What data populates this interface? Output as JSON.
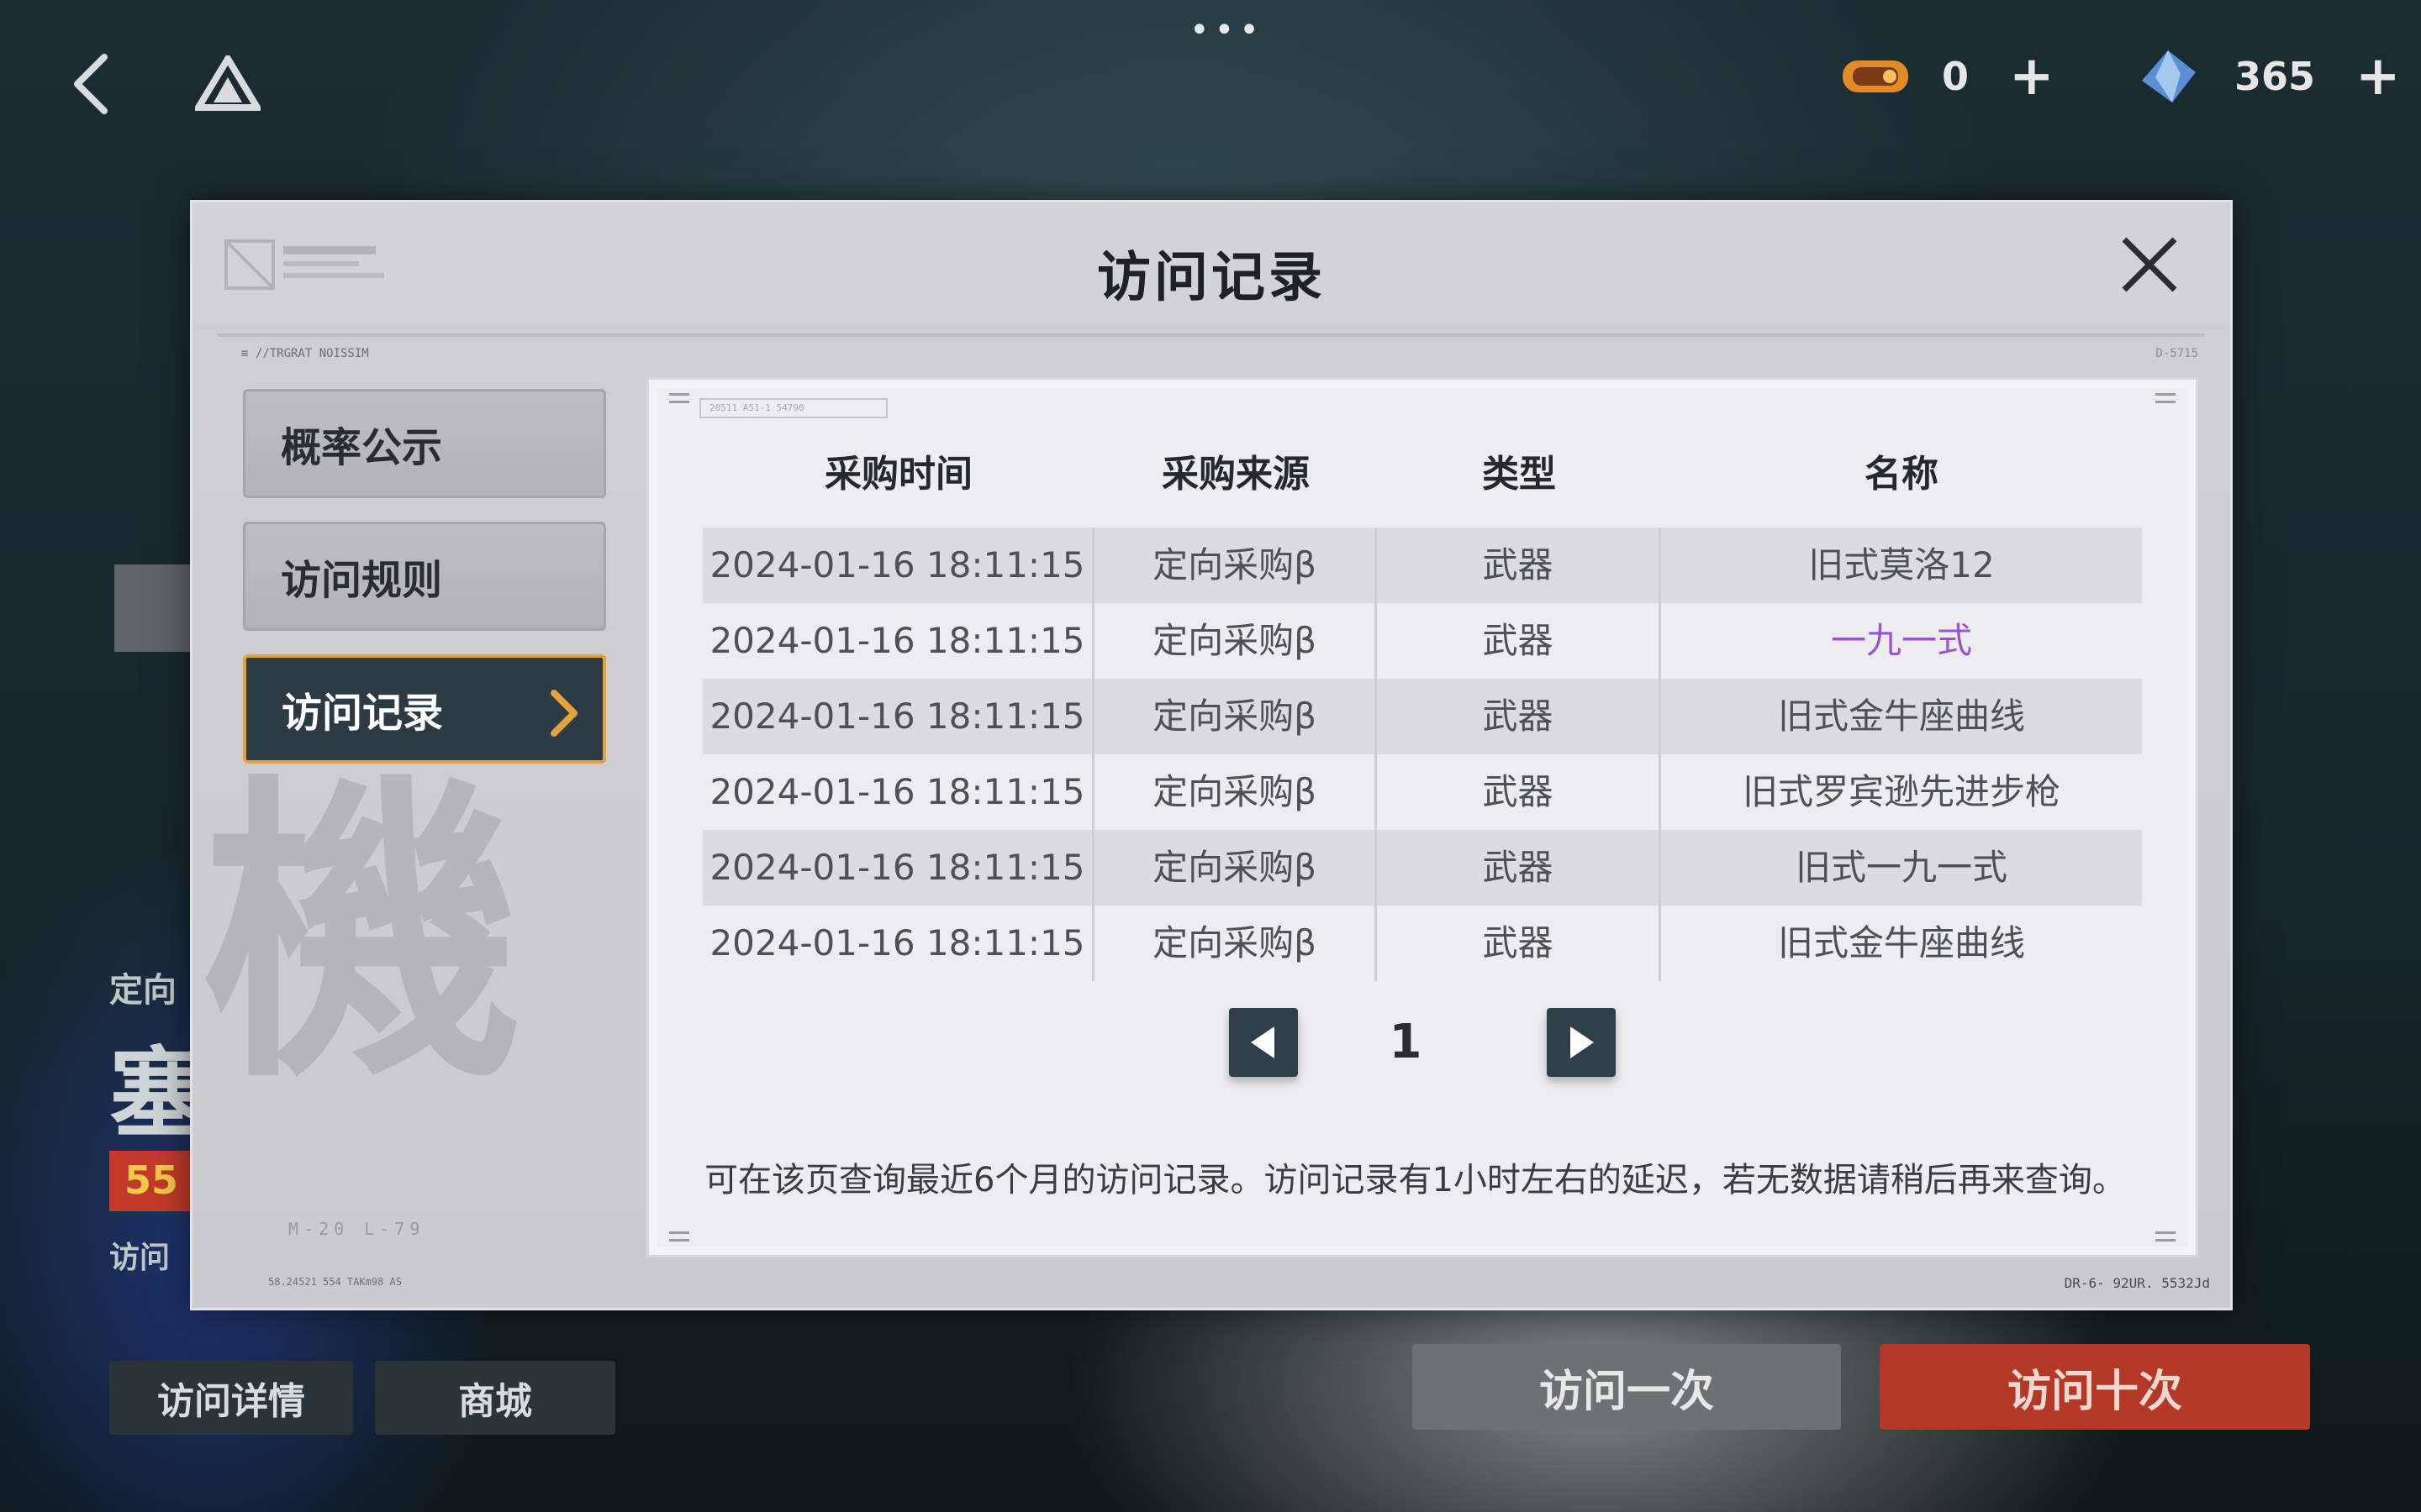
{
  "top_bar": {
    "resource1": {
      "icon": "ticket-icon",
      "value": "0"
    },
    "resource2": {
      "icon": "crystal-icon",
      "value": "365"
    }
  },
  "background": {
    "event_label": "定向",
    "event_title": "塞",
    "badge": "55",
    "sub_label": "访问",
    "buttons": {
      "detail": "访问详情",
      "shop": "商城",
      "once": "访问一次",
      "ten": "访问十次"
    }
  },
  "modal": {
    "title": "访问记录",
    "code_left": "≡ //TRGRAT NOISSIM",
    "code_right": "D-5715",
    "code_bottom_right": "DR-6- 92UR. 5532Jd",
    "code_bottom_left": "58.24521   554  TAKm98   AS",
    "panel_tag": "20511   A51-1   54790",
    "side_deco_char": "機",
    "side_deco_code": "M-20 L-79",
    "sidebar": [
      {
        "label": "概率公示",
        "active": false
      },
      {
        "label": "访问规则",
        "active": false
      },
      {
        "label": "访问记录",
        "active": true
      }
    ],
    "table": {
      "headers": [
        "采购时间",
        "采购来源",
        "类型",
        "名称"
      ],
      "rows": [
        {
          "time": "2024-01-16 18:11:15",
          "source": "定向采购β",
          "type": "武器",
          "name": "旧式莫洛12",
          "rarity": "normal"
        },
        {
          "time": "2024-01-16 18:11:15",
          "source": "定向采购β",
          "type": "武器",
          "name": "一九一式",
          "rarity": "epic"
        },
        {
          "time": "2024-01-16 18:11:15",
          "source": "定向采购β",
          "type": "武器",
          "name": "旧式金牛座曲线",
          "rarity": "normal"
        },
        {
          "time": "2024-01-16 18:11:15",
          "source": "定向采购β",
          "type": "武器",
          "name": "旧式罗宾逊先进步枪",
          "rarity": "normal"
        },
        {
          "time": "2024-01-16 18:11:15",
          "source": "定向采购β",
          "type": "武器",
          "name": "旧式一九一式",
          "rarity": "normal"
        },
        {
          "time": "2024-01-16 18:11:15",
          "source": "定向采购β",
          "type": "武器",
          "name": "旧式金牛座曲线",
          "rarity": "normal"
        }
      ]
    },
    "pagination": {
      "page": "1"
    },
    "note": "可在该页查询最近6个月的访问记录。访问记录有1小时左右的延迟，若无数据请稍后再来查询。"
  },
  "colors": {
    "active_tab_bg": "#2c3a44",
    "active_tab_border": "#e2a33a",
    "epic_text": "#9a52d8",
    "ten_button": "#b43826"
  }
}
